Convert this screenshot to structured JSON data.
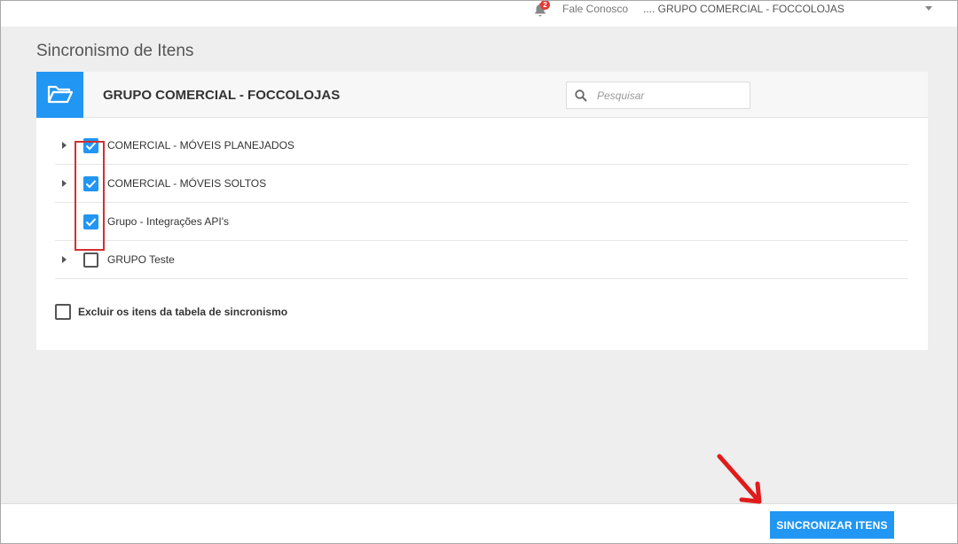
{
  "header": {
    "notification_count": "2",
    "contact_label": "Fale Conosco",
    "company_selector": ".... GRUPO COMERCIAL - FOCCOLOJAS"
  },
  "page": {
    "title": "Sincronismo de Itens"
  },
  "card": {
    "title": "GRUPO COMERCIAL - FOCCOLOJAS",
    "search_placeholder": "Pesquisar",
    "items": [
      {
        "label": "COMERCIAL - MÓVEIS PLANEJADOS",
        "checked": true,
        "expandable": true
      },
      {
        "label": "COMERCIAL - MÓVEIS SOLTOS",
        "checked": true,
        "expandable": true
      },
      {
        "label": "Grupo - Integrações API's",
        "checked": true,
        "expandable": false
      },
      {
        "label": "GRUPO Teste",
        "checked": false,
        "expandable": true
      }
    ],
    "exclude_label": "Excluir os itens da tabela de sincronismo"
  },
  "footer": {
    "sync_button": "SINCRONIZAR ITENS"
  },
  "colors": {
    "accent": "#2196f3",
    "annotation": "#d32f2f",
    "background": "#eeeeee"
  },
  "icons": [
    "bell-icon",
    "folder-open-icon",
    "search-icon",
    "caret-down-icon",
    "expand-arrow-icon",
    "check-icon"
  ]
}
